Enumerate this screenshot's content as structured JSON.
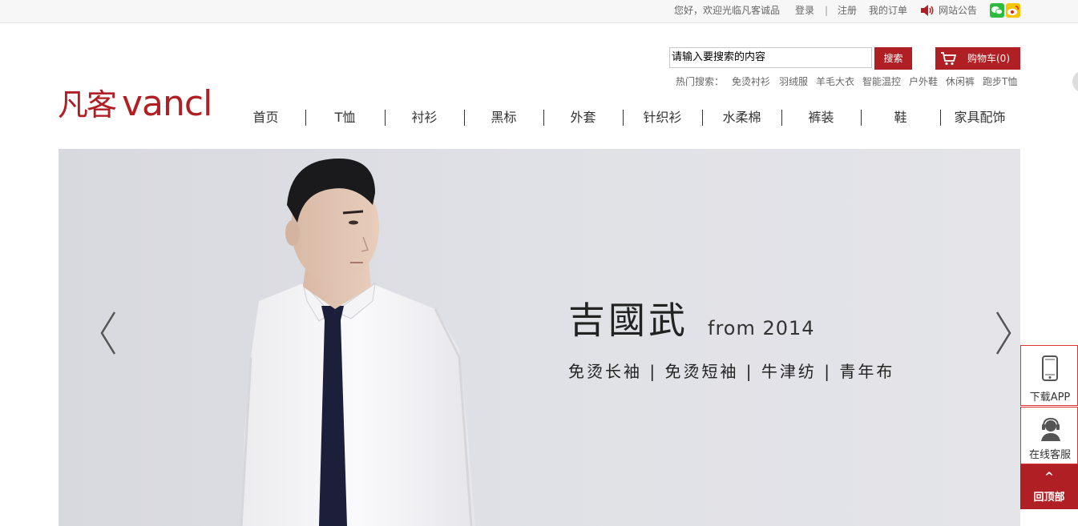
{
  "topbar": {
    "welcome": "您好，欢迎光临凡客诚品",
    "login": "登录",
    "sep": "|",
    "register": "注册",
    "my_orders": "我的订单",
    "notice": "网站公告"
  },
  "logo": {
    "cn": "凡客",
    "en": "vancl"
  },
  "search": {
    "value": "请输入要搜索的内容",
    "button": "搜索"
  },
  "cart": {
    "label": "购物车(0)"
  },
  "hot_search": {
    "label": "热门搜索：",
    "items": [
      "免烫衬衫",
      "羽绒服",
      "羊毛大衣",
      "智能温控",
      "户外鞋",
      "休闲裤",
      "跑步T恤"
    ]
  },
  "nav": [
    "首页",
    "T恤",
    "衬衫",
    "黑标",
    "外套",
    "针织衫",
    "水柔棉",
    "裤装",
    "鞋",
    "家具配饰"
  ],
  "banner": {
    "headline": "吉國武",
    "from": "from 2014",
    "subtitle": "免烫长袖 | 免烫短袖 | 牛津纺 | 青年布"
  },
  "side": {
    "app": "下载APP",
    "service": "在线客服",
    "top": "回顶部",
    "top_arrow": "^"
  },
  "colors": {
    "brand_red": "#b01f24",
    "top_bar_bg": "#f7f7f7"
  }
}
